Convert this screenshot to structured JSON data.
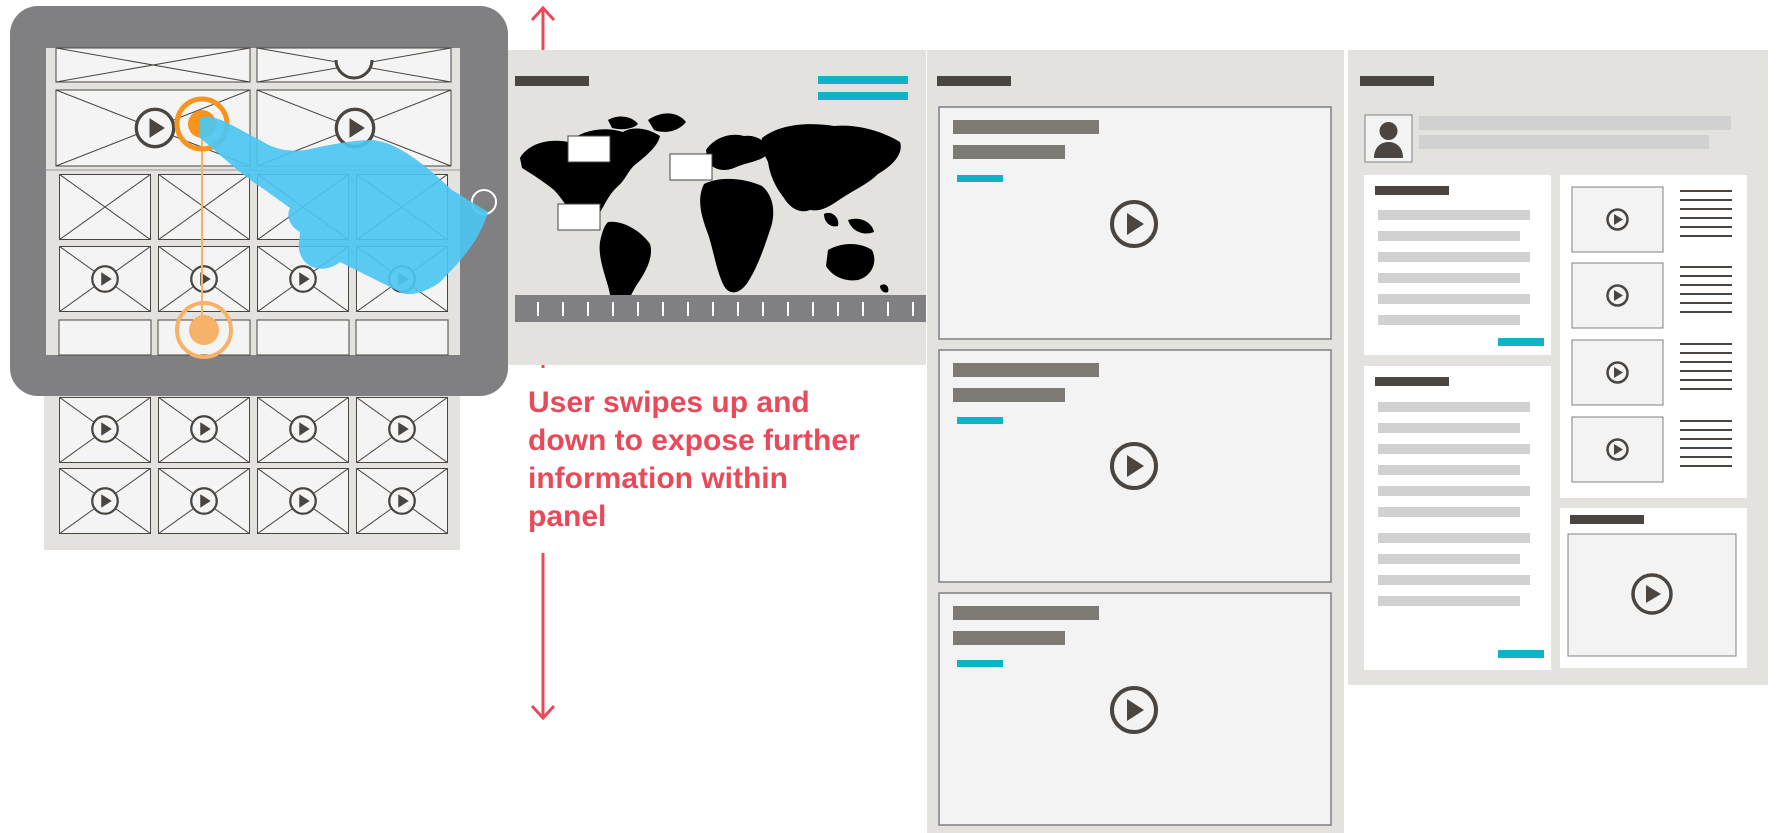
{
  "annotation": {
    "text": "User swipes up and down to expose further information within panel"
  },
  "colors": {
    "accent_teal": "#11b2c8",
    "annotation_red": "#e84a5a",
    "touch_orange": "#f7941d",
    "hand_blue": "#4cc6f2",
    "tablet_frame": "#808083",
    "panel_bg": "#e3e2df",
    "card_bg": "#f3f3f3",
    "dark_bar": "#4a4540",
    "mid_bar": "#7d7a76",
    "light_bar": "#d1d1d1"
  },
  "icons": [
    "play-icon",
    "user-avatar-icon",
    "world-map-icon",
    "hand-pointer-icon",
    "home-button-icon",
    "touch-point-icon"
  ]
}
